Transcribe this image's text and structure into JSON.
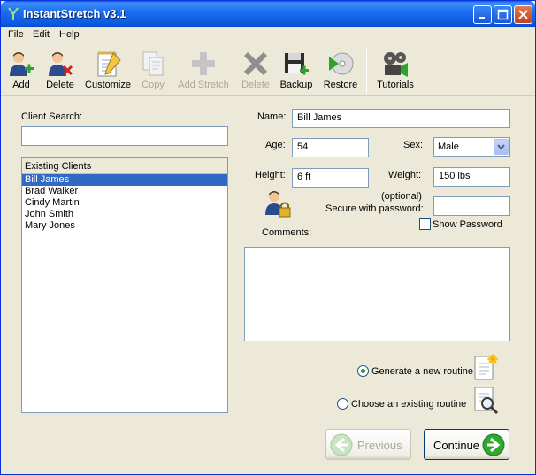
{
  "window": {
    "title": "InstantStretch v3.1"
  },
  "menu": [
    "File",
    "Edit",
    "Help"
  ],
  "toolbar": {
    "add": "Add",
    "delete_client": "Delete",
    "customize": "Customize",
    "copy": "Copy",
    "add_stretch": "Add Stretch",
    "delete_stretch": "Delete",
    "backup": "Backup",
    "restore": "Restore",
    "tutorials": "Tutorials"
  },
  "client_search": {
    "label": "Client Search:",
    "value": ""
  },
  "clients": {
    "header": "Existing Clients",
    "items": [
      "Bill James",
      "Brad Walker",
      "Cindy Martin",
      "John Smith",
      "Mary Jones"
    ],
    "selected": "Bill James"
  },
  "form": {
    "name_label": "Name:",
    "name_value": "Bill James",
    "age_label": "Age:",
    "age_value": "54",
    "sex_label": "Sex:",
    "sex_value": "Male",
    "height_label": "Height:",
    "height_value": "6 ft",
    "weight_label": "Weight:",
    "weight_value": "150 lbs",
    "optional_label": "(optional)",
    "password_label": "Secure with password:",
    "password_value": "",
    "show_password_label": "Show Password",
    "comments_label": "Comments:",
    "comments_value": ""
  },
  "routine": {
    "generate_label": "Generate a new routine",
    "choose_label": "Choose an existing routine",
    "selected": "generate"
  },
  "buttons": {
    "previous": "Previous",
    "continue": "Continue"
  },
  "colors": {
    "titlebar": "#0b58dc",
    "selection": "#316ac5",
    "window_bg": "#ece9d8"
  }
}
